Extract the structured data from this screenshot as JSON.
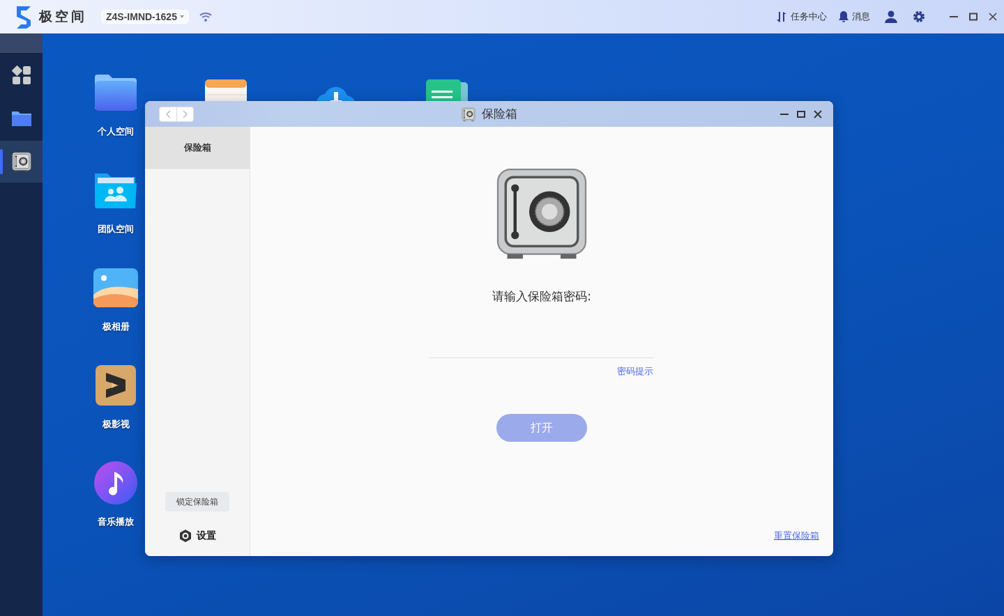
{
  "topbar": {
    "brand": "极空间",
    "device": "Z4S-IMND-1625",
    "actions": [
      {
        "kind": "tasks",
        "label": "任务中心"
      },
      {
        "kind": "bell",
        "label": "消息"
      }
    ]
  },
  "dock": [
    {
      "kind": "apps",
      "selected": false
    },
    {
      "kind": "folder",
      "selected": false
    },
    {
      "kind": "safe",
      "selected": true
    }
  ],
  "desktop_icons": [
    {
      "kind": "folder",
      "label": "个人空间"
    },
    {
      "kind": "team",
      "label": "团队空间"
    },
    {
      "kind": "photos",
      "label": "极相册"
    },
    {
      "kind": "video",
      "label": "极影视"
    },
    {
      "kind": "music",
      "label": "音乐播放"
    }
  ],
  "top_row_icons": [
    {
      "kind": "notes"
    },
    {
      "kind": "cloud"
    },
    {
      "kind": "doc"
    }
  ],
  "window": {
    "title": "保险箱",
    "sidebar": {
      "items": [
        {
          "label": "保险箱",
          "selected": true
        }
      ],
      "lock_button": "锁定保险箱",
      "settings": "设置"
    },
    "prompt": "请输入保险箱密码:",
    "hint_link": "密码提示",
    "open_button": {
      "label": "打开",
      "disabled": true
    },
    "reset_link": "重置保险箱"
  }
}
